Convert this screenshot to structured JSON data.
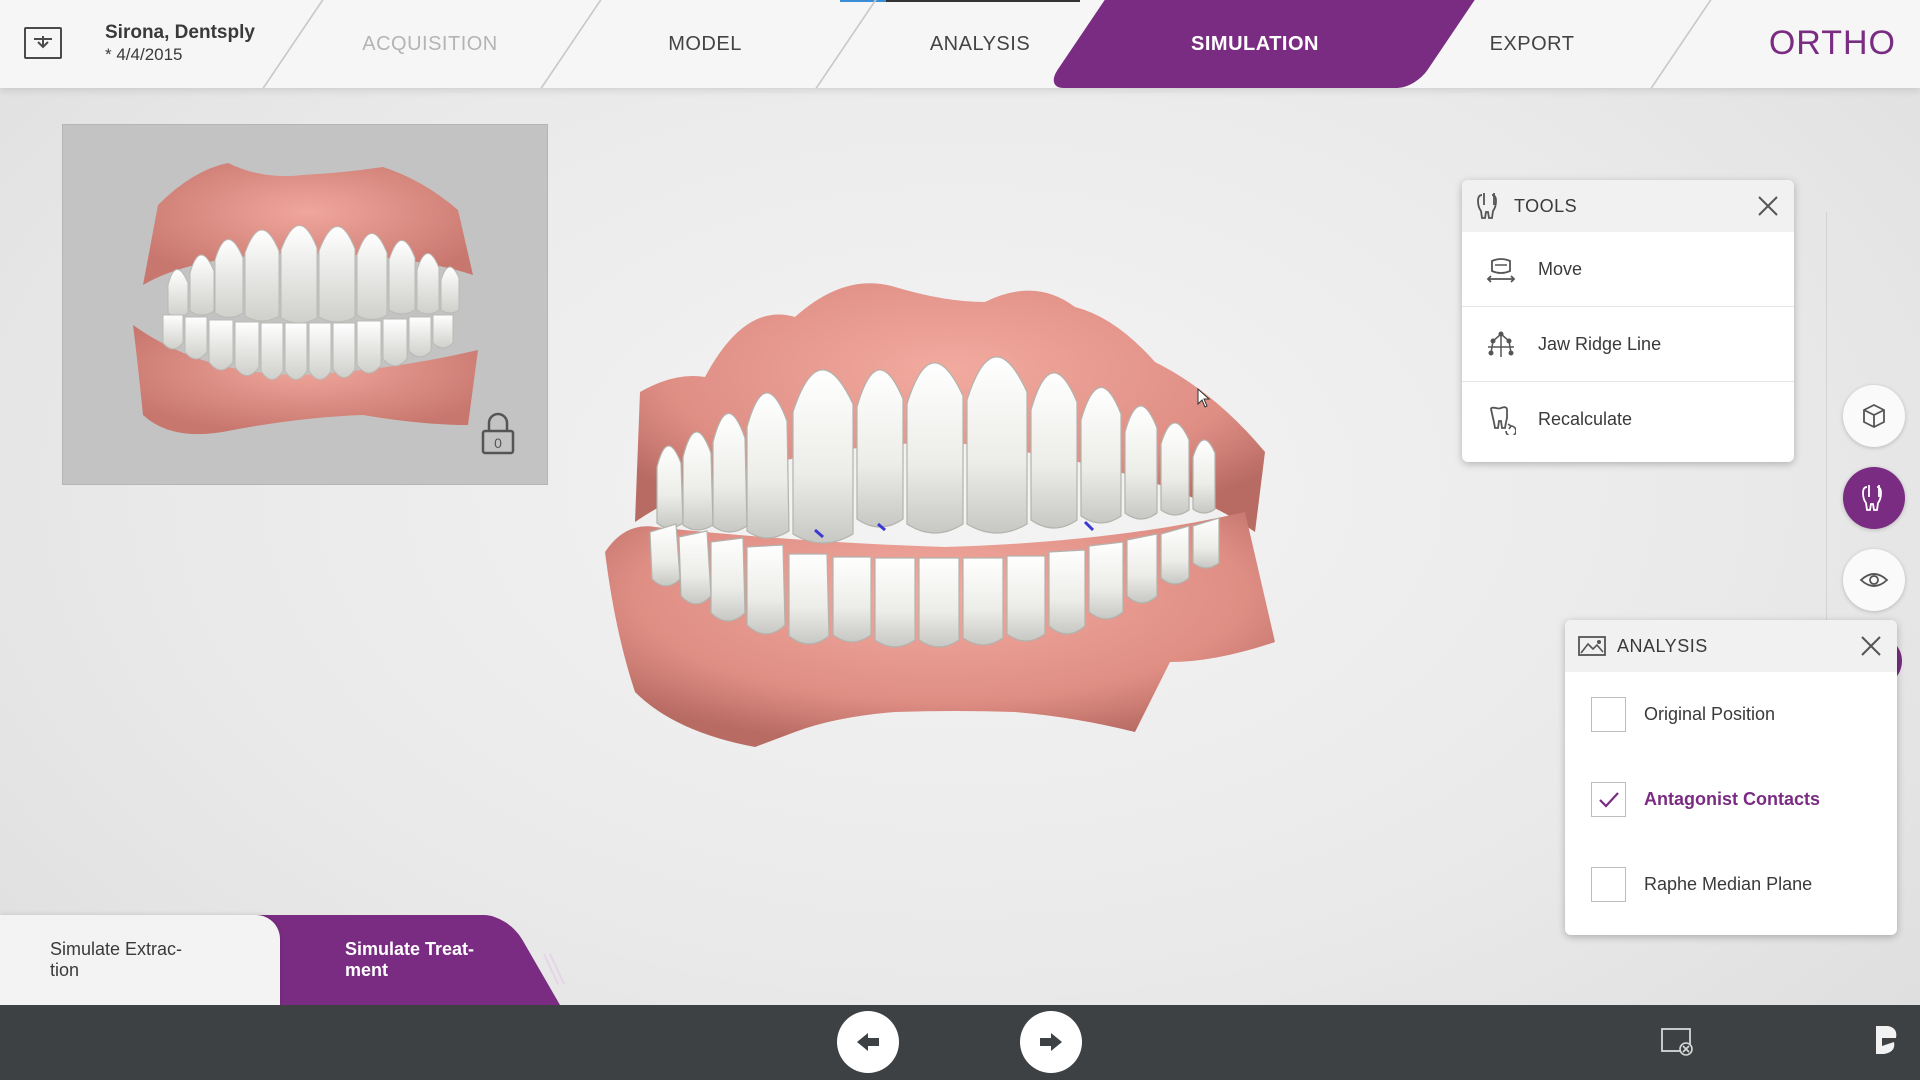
{
  "header": {
    "patient_name": "Sirona, Dentsply",
    "patient_date": "* 4/4/2015",
    "brand": "ORTHO",
    "tabs": [
      {
        "label": "ACQUISITION",
        "state": "disabled"
      },
      {
        "label": "MODEL",
        "state": "normal"
      },
      {
        "label": "ANALYSIS",
        "state": "normal"
      },
      {
        "label": "SIMULATION",
        "state": "active"
      },
      {
        "label": "EXPORT",
        "state": "normal"
      }
    ]
  },
  "tools_panel": {
    "title": "TOOLS",
    "items": [
      {
        "label": "Move",
        "icon": "move-jaw-icon"
      },
      {
        "label": "Jaw Ridge Line",
        "icon": "jaw-ridge-line-icon"
      },
      {
        "label": "Recalculate",
        "icon": "recalculate-tooth-icon"
      }
    ]
  },
  "analysis_panel": {
    "title": "ANALYSIS",
    "options": [
      {
        "label": "Original Position",
        "checked": false
      },
      {
        "label": "Antagonist Contacts",
        "checked": true
      },
      {
        "label": "Raphe Median Plane",
        "checked": false
      }
    ]
  },
  "side_buttons": [
    {
      "icon": "cube-view-icon",
      "active": false
    },
    {
      "icon": "tools-icon",
      "active": true
    },
    {
      "icon": "eye-icon",
      "active": false
    }
  ],
  "workflow_steps": {
    "left": "Simulate Extrac-\ntion",
    "right": "Simulate Treat-\nment"
  },
  "colors": {
    "accent": "#7a2c82",
    "bottom_bar": "#3d4144",
    "gum": "#e4938a",
    "teeth": "#eeeeea"
  },
  "thumbnail": {
    "lock_icon": "lock-icon",
    "lock_value": "0"
  }
}
